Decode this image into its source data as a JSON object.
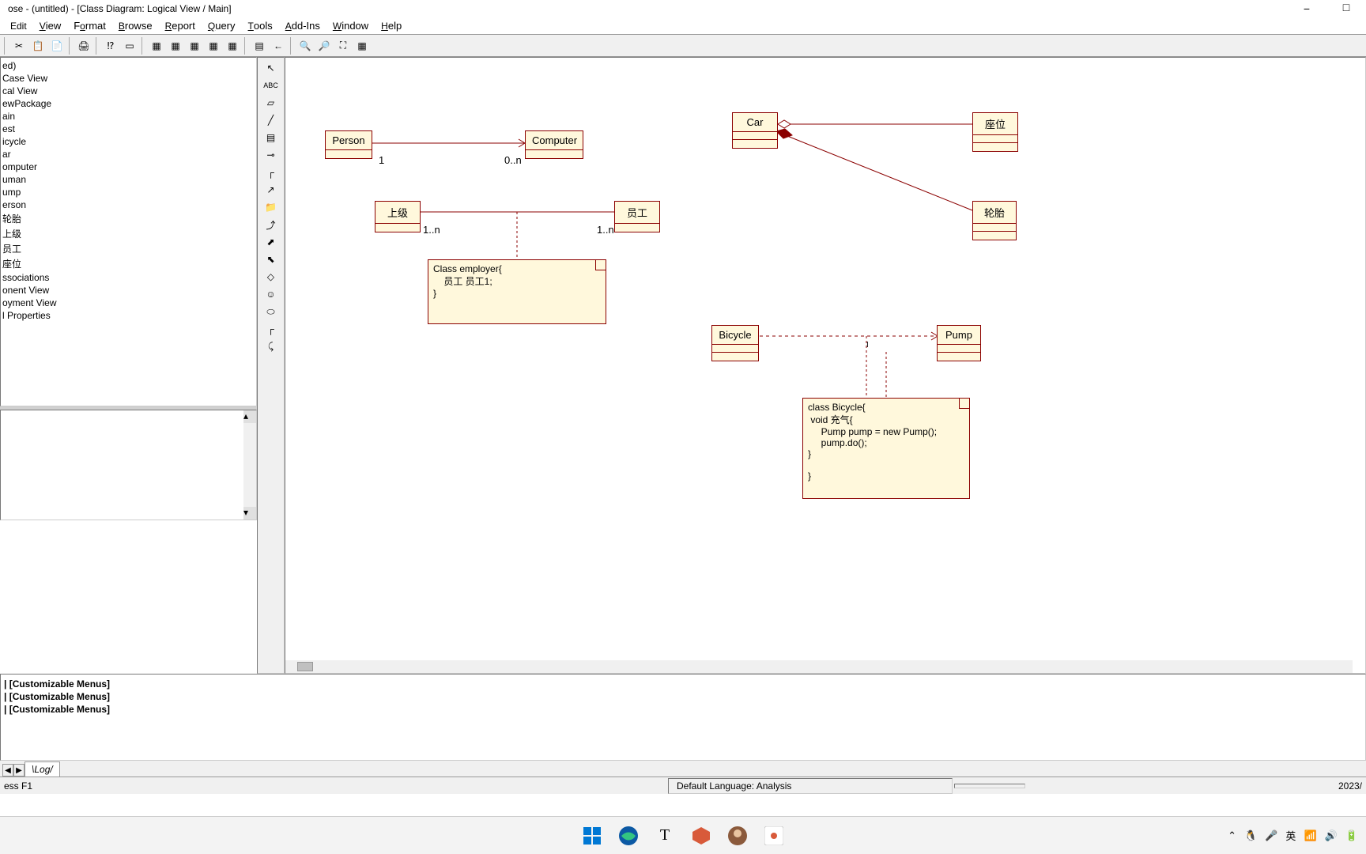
{
  "window": {
    "title": "ose - (untitled) - [Class Diagram: Logical View / Main]"
  },
  "menu": {
    "edit": "Edit",
    "view": "View",
    "format": "Format",
    "browse": "Browse",
    "report": "Report",
    "query": "Query",
    "tools": "Tools",
    "addins": "Add-Ins",
    "window": "Window",
    "help": "Help"
  },
  "tree": {
    "items": [
      "ed)",
      "Case View",
      "cal View",
      "ewPackage",
      "ain",
      "est",
      "icycle",
      "ar",
      "omputer",
      "uman",
      "ump",
      "erson",
      "轮胎",
      "上级",
      "员工",
      "座位",
      "ssociations",
      "onent View",
      "oyment View",
      "l Properties"
    ]
  },
  "diagram": {
    "classes": {
      "person": "Person",
      "computer": "Computer",
      "car": "Car",
      "seat": "座位",
      "boss": "上级",
      "employee": "员工",
      "wheel": "轮胎",
      "bicycle": "Bicycle",
      "pump": "Pump"
    },
    "multiplicity": {
      "person_1": "1",
      "computer_0n": "0..n",
      "boss_1n": "1..n",
      "employee_1n": "1..n"
    },
    "notes": {
      "employer": "Class employer{\n    员工 员工1;\n}",
      "bicycle": "class Bicycle{\n void 充气{\n     Pump pump = new Pump();\n     pump.do();\n}\n\n}"
    }
  },
  "log": {
    "lines": [
      "| [Customizable Menus]",
      "| [Customizable Menus]",
      "| [Customizable Menus]"
    ],
    "tab": "Log"
  },
  "status": {
    "help": "ess F1",
    "lang": "Default Language: Analysis",
    "date": "2023/"
  },
  "systray": {
    "ime": "英"
  }
}
